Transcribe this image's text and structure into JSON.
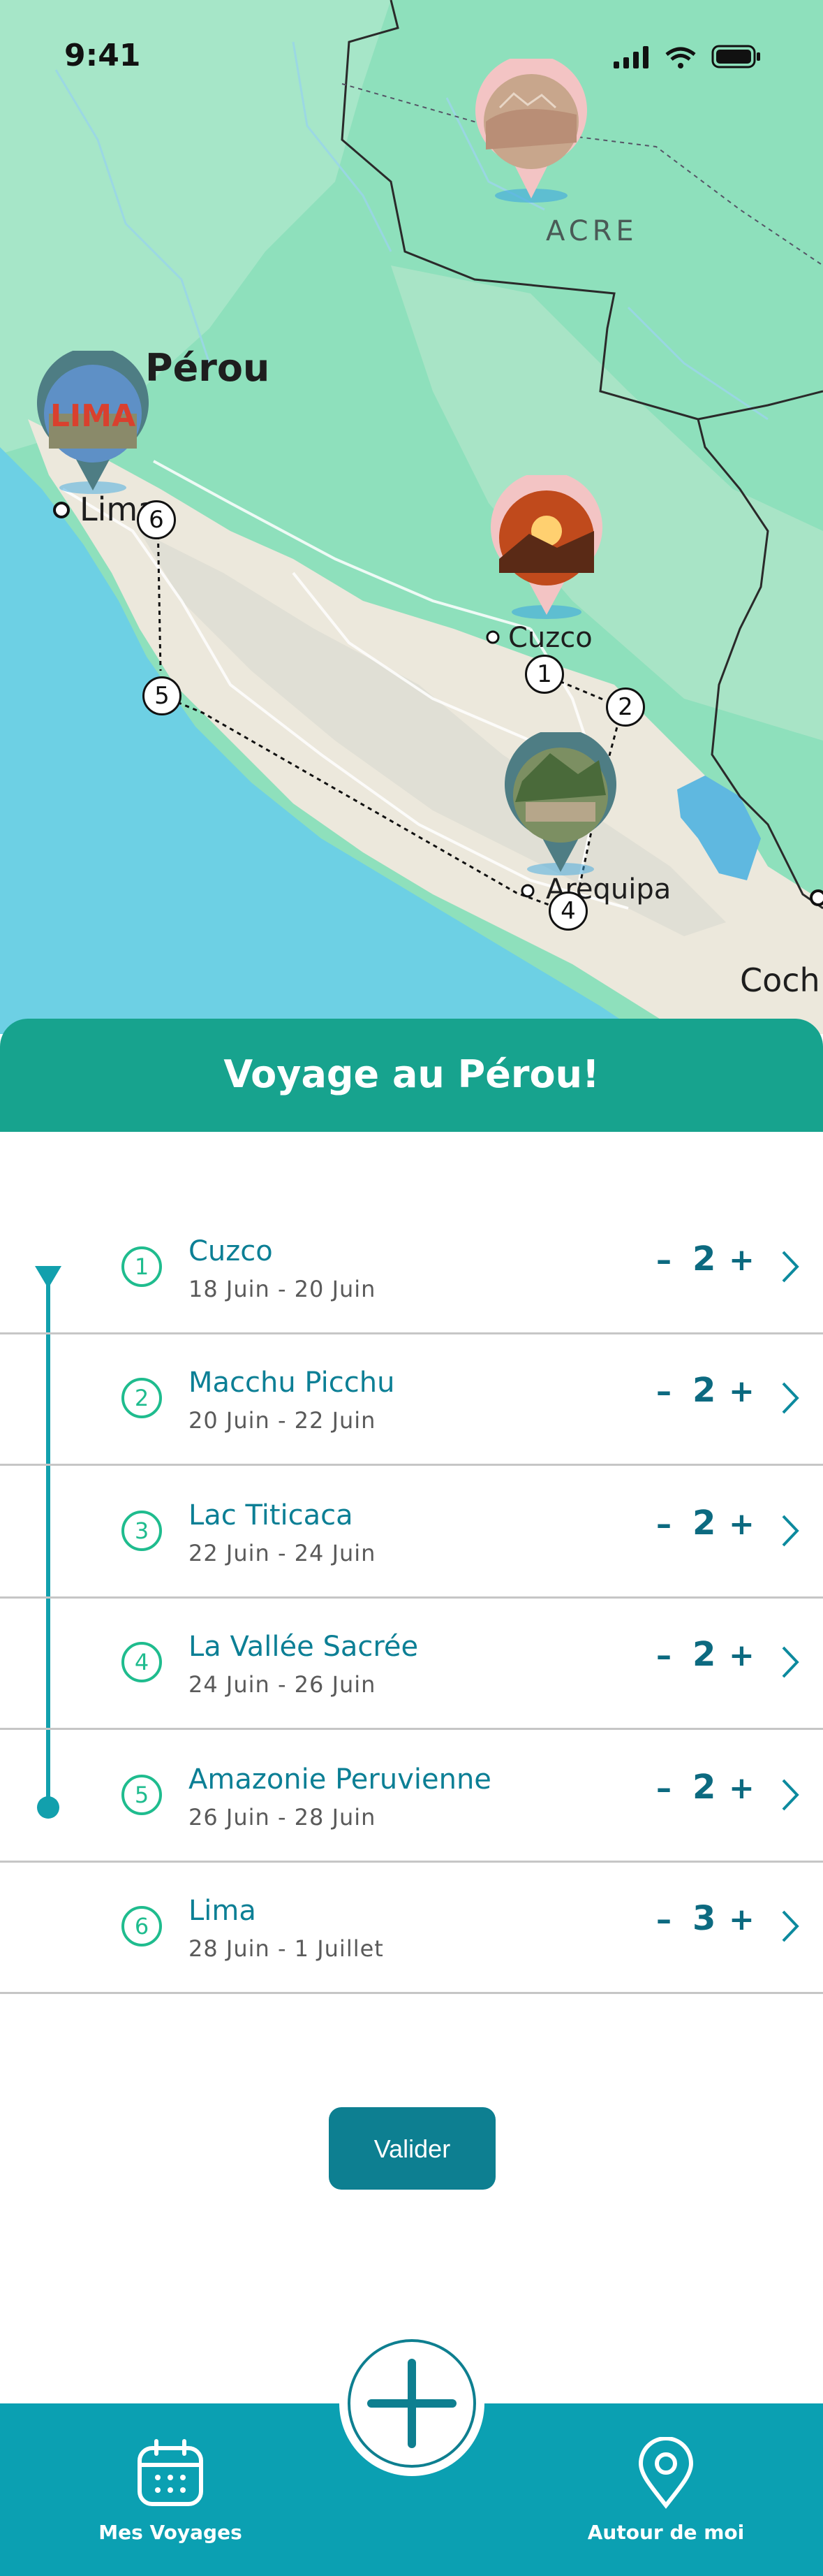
{
  "status_bar": {
    "time": "9:41"
  },
  "map": {
    "labels": {
      "acre": "ACRE",
      "country": "Pérou",
      "lima": "Lima",
      "cuzco": "Cuzco",
      "arequipa": "Arequipa",
      "coch": "Coch"
    },
    "route_markers": [
      "1",
      "2",
      "4",
      "5",
      "6"
    ],
    "pin_lima_text": "LIMA"
  },
  "trip": {
    "title": "Voyage au Pérou!"
  },
  "stops": [
    {
      "number": "1",
      "name": "Cuzco",
      "dates": "18 Juin - 20 Juin",
      "nights": "2"
    },
    {
      "number": "2",
      "name": "Macchu Picchu",
      "dates": "20 Juin - 22 Juin",
      "nights": "2"
    },
    {
      "number": "3",
      "name": "Lac Titicaca",
      "dates": "22 Juin - 24 Juin",
      "nights": "2"
    },
    {
      "number": "4",
      "name": "La Vallée Sacrée",
      "dates": "24 Juin - 26 Juin",
      "nights": "2"
    },
    {
      "number": "5",
      "name": "Amazonie Peruvienne",
      "dates": "26 Juin - 28 Juin",
      "nights": "2"
    },
    {
      "number": "6",
      "name": "Lima",
      "dates": "28 Juin - 1 Juillet",
      "nights": "3"
    }
  ],
  "stepper_symbols": {
    "minus": "–",
    "plus": "+"
  },
  "actions": {
    "validate": "Valider"
  },
  "bottom_nav": {
    "voyages": "Mes Voyages",
    "nearby": "Autour de moi"
  },
  "colors": {
    "header": "#17a38e",
    "accent_teal": "#0ba0b2",
    "stepper_text": "#0c6a80",
    "stop_circle": "#1fbc8e",
    "button": "#0d7f91"
  },
  "icons": {
    "signal": "signal-icon",
    "wifi": "wifi-icon",
    "battery": "battery-icon",
    "calendar": "calendar-icon",
    "location": "location-pin-icon",
    "add": "plus-icon",
    "chevron": "chevron-right-icon"
  }
}
